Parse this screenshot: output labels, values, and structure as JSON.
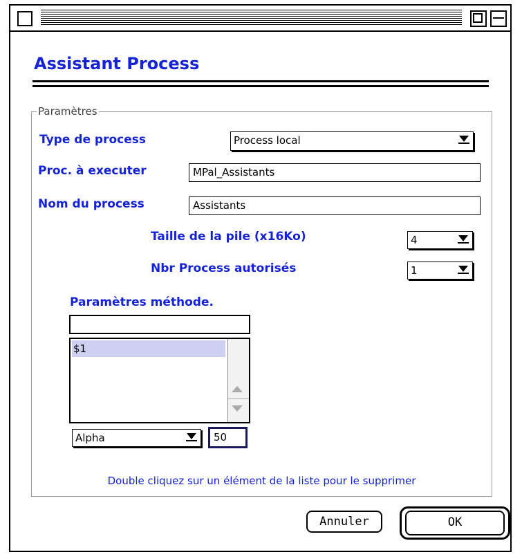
{
  "window": {
    "heading": "Assistant Process"
  },
  "group": {
    "label": "Paramètres"
  },
  "fields": {
    "type_label": "Type de process",
    "type_value": "Process local",
    "proc_label": "Proc. à executer",
    "proc_value": "MPal_Assistants",
    "nom_label": "Nom du process",
    "nom_value": "Assistants",
    "pile_label": "Taille de la pile (x16Ko)",
    "pile_value": "4",
    "nbr_label": "Nbr Process autorisés",
    "nbr_value": "1"
  },
  "method_params": {
    "label": "Paramètres méthode.",
    "input_value": "",
    "items": [
      "$1"
    ],
    "type_value": "Alpha",
    "size_value": "50"
  },
  "note": "Double cliquez sur un élément de la liste pour le supprimer",
  "buttons": {
    "cancel": "Annuler",
    "ok": "OK"
  },
  "colors": {
    "label_blue": "#1422d8",
    "selection": "#cdd0f3"
  }
}
